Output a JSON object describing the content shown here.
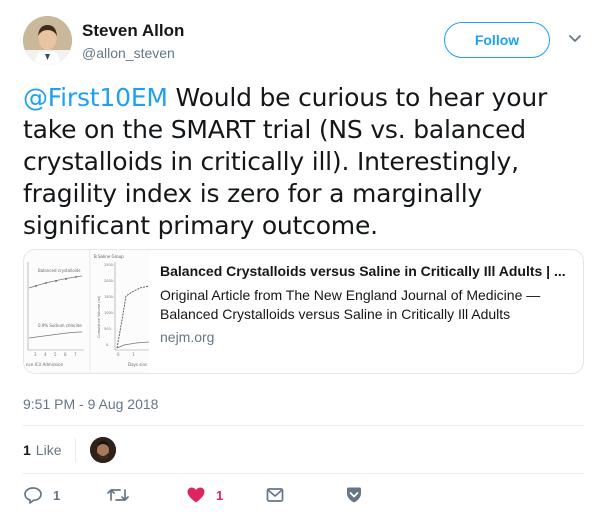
{
  "author": {
    "name": "Steven Allon",
    "handle": "@allon_steven",
    "follow_label": "Follow"
  },
  "tweet": {
    "mention": "@First10EM",
    "text": " Would be curious to hear your take on the SMART trial (NS vs. balanced crystalloids in critically ill). Interestingly, fragility index is zero for a marginally significant primary outcome."
  },
  "card": {
    "title": "Balanced Crystalloids versus Saline in Critically Ill Adults | ...",
    "description": "Original Article from The New England Journal of Medicine — Balanced Crystalloids versus Saline in Critically Ill Adults",
    "domain": "nejm.org",
    "thumb_labels": {
      "panel_label": "B  Saline Group",
      "balanced": "Balanced crystalloids",
      "saline": "0.9% Sodium chloride",
      "x_label_left": "nce ICU Admission",
      "x_label_right": "Days sinc",
      "y_label": "Cumulative Volume (ml)",
      "y_ticks": [
        "2500-",
        "2000-",
        "1500-",
        "1000-",
        "500-",
        "0-"
      ],
      "x_ticks": [
        "3",
        "4",
        "5",
        "6",
        "7"
      ],
      "x_ticks_right": [
        "0",
        "1"
      ]
    }
  },
  "timestamp": "9:51 PM - 9 Aug 2018",
  "stats": {
    "likes_count": "1",
    "likes_label": "Like"
  },
  "actions": {
    "reply_count": "1",
    "retweet_count": "",
    "like_count": "1"
  },
  "colors": {
    "accent": "#1da1f2",
    "like": "#e0245e",
    "muted": "#657786"
  },
  "icons": {
    "caret": "chevron-down-icon",
    "reply": "reply-icon",
    "retweet": "retweet-icon",
    "like": "heart-icon",
    "dm": "envelope-icon",
    "bookmark": "bookmark-icon"
  }
}
